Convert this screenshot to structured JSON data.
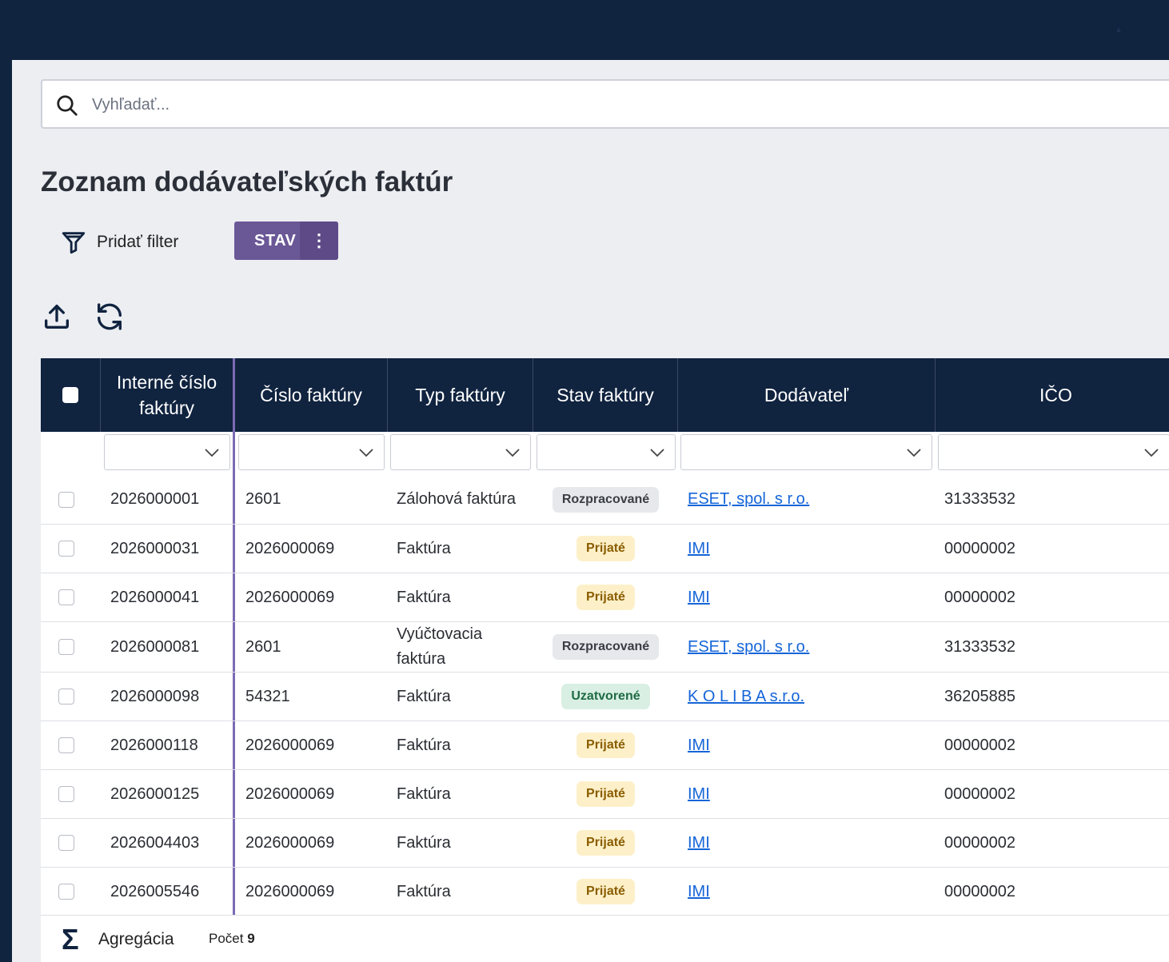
{
  "search": {
    "placeholder": "Vyhľadať..."
  },
  "page": {
    "title": "Zoznam dodávateľských faktúr"
  },
  "toolbar": {
    "add_filter_label": "Pridať filter",
    "chip_label": "STAV",
    "chip_menu_icon": "⋮",
    "export_icon": "upload-icon",
    "refresh_icon": "refresh-icon"
  },
  "table": {
    "columns": [
      "Interné číslo faktúry",
      "Číslo faktúry",
      "Typ faktúry",
      "Stav faktúry",
      "Dodávateľ",
      "IČO"
    ],
    "rows": [
      {
        "internal": "2026000001",
        "number": "2601",
        "type": "Zálohová faktúra",
        "status": "Rozpracované",
        "status_kind": "rozp",
        "supplier": "ESET, spol. s r.o.",
        "ico": "31333532"
      },
      {
        "internal": "2026000031",
        "number": "2026000069",
        "type": "Faktúra",
        "status": "Prijaté",
        "status_kind": "prij",
        "supplier": "IMI",
        "ico": "00000002"
      },
      {
        "internal": "2026000041",
        "number": "2026000069",
        "type": "Faktúra",
        "status": "Prijaté",
        "status_kind": "prij",
        "supplier": "IMI",
        "ico": "00000002"
      },
      {
        "internal": "2026000081",
        "number": "2601",
        "type": "Vyúčtovacia faktúra",
        "status": "Rozpracované",
        "status_kind": "rozp",
        "supplier": "ESET, spol. s r.o.",
        "ico": "31333532"
      },
      {
        "internal": "2026000098",
        "number": "54321",
        "type": "Faktúra",
        "status": "Uzatvorené",
        "status_kind": "uzav",
        "supplier": "K O L I B A s.r.o.",
        "ico": "36205885"
      },
      {
        "internal": "2026000118",
        "number": "2026000069",
        "type": "Faktúra",
        "status": "Prijaté",
        "status_kind": "prij",
        "supplier": "IMI",
        "ico": "00000002"
      },
      {
        "internal": "2026000125",
        "number": "2026000069",
        "type": "Faktúra",
        "status": "Prijaté",
        "status_kind": "prij",
        "supplier": "IMI",
        "ico": "00000002"
      },
      {
        "internal": "2026004403",
        "number": "2026000069",
        "type": "Faktúra",
        "status": "Prijaté",
        "status_kind": "prij",
        "supplier": "IMI",
        "ico": "00000002"
      },
      {
        "internal": "2026005546",
        "number": "2026000069",
        "type": "Faktúra",
        "status": "Prijaté",
        "status_kind": "prij",
        "supplier": "IMI",
        "ico": "00000002"
      }
    ]
  },
  "footer": {
    "sigma_icon": "Σ",
    "aggregation_label": "Agregácia",
    "count_label": "Počet",
    "count_value": "9"
  },
  "colors": {
    "header_bg": "#10233f",
    "chip_bg": "#6a5796",
    "link": "#1565d8"
  }
}
